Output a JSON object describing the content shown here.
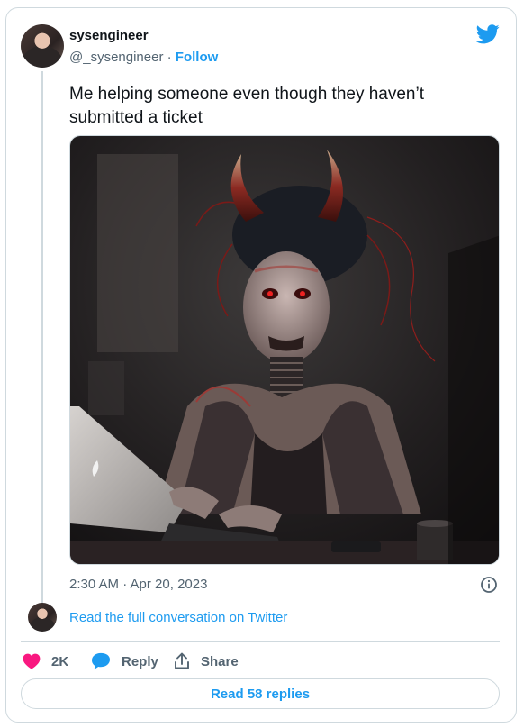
{
  "tweet": {
    "author_name": "sysengineer",
    "handle": "@_sysengineer",
    "separator": "·",
    "follow_label": "Follow",
    "text": "Me helping someone even though they haven’t submitted a ticket",
    "timestamp": "2:30 AM · Apr 20, 2023"
  },
  "conversation": {
    "read_full_label": "Read the full conversation on Twitter"
  },
  "actions": {
    "like_count": "2K",
    "reply_label": "Reply",
    "share_label": "Share"
  },
  "footer": {
    "read_replies_label": "Read 58 replies"
  },
  "icons": {
    "brand": "twitter-bird-icon",
    "like": "heart-icon",
    "reply": "speech-bubble-icon",
    "share": "share-arrow-icon",
    "info": "info-icon"
  },
  "colors": {
    "accent": "#1d9bf0",
    "like": "#f91880",
    "muted": "#536471",
    "border": "#cfd9de"
  }
}
